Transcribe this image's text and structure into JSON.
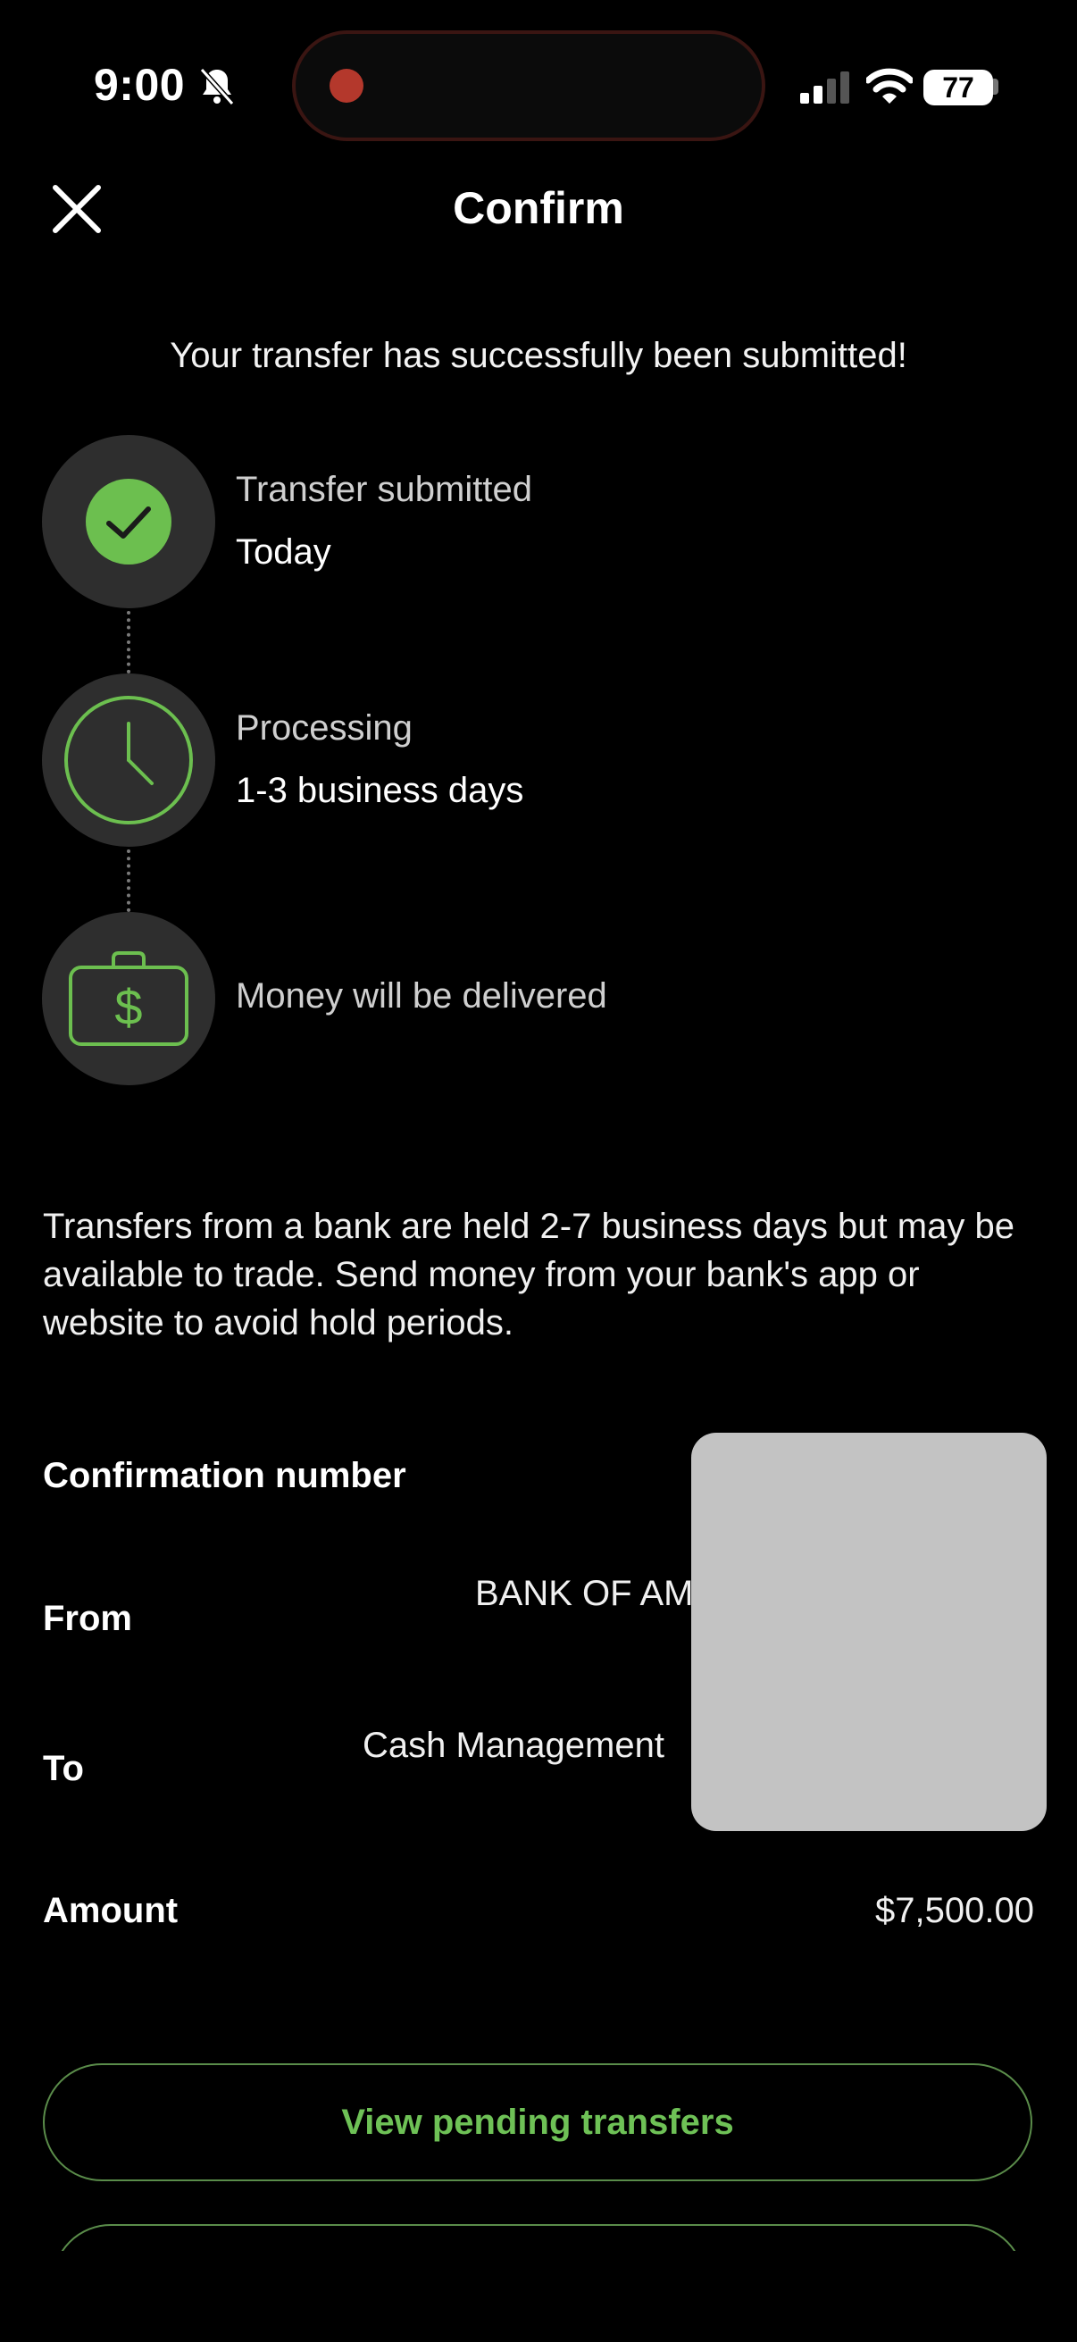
{
  "status_bar": {
    "time": "9:00",
    "battery": "77",
    "icons": [
      "bell-slash-icon",
      "signal-icon",
      "wifi-icon",
      "battery-icon"
    ]
  },
  "header": {
    "title": "Confirm",
    "close_icon": "close-icon"
  },
  "success_message": "Your transfer has successfully been submitted!",
  "timeline": [
    {
      "label": "Transfer submitted",
      "sub": "Today",
      "icon": "check-circle-icon"
    },
    {
      "label": "Processing",
      "sub": "1-3 business days",
      "icon": "clock-icon"
    },
    {
      "label": "Money will be delivered",
      "sub": "",
      "icon": "money-bag-icon"
    }
  ],
  "note": "Transfers from a bank are held 2-7 business days but may be available to trade. Send money from your bank's app or website to avoid hold periods.",
  "details": {
    "confirmation_label": "Confirmation number",
    "from_label": "From",
    "from_value": "BANK OF AM",
    "to_label": "To",
    "to_value": "Cash Management",
    "amount_label": "Amount",
    "amount_value": "$7,500.00"
  },
  "buttons": {
    "view_pending": "View pending transfers"
  },
  "colors": {
    "accent": "#6ec156",
    "check_fill": "#6cbf4f",
    "background": "#000000",
    "circle": "#2e2e2e"
  }
}
